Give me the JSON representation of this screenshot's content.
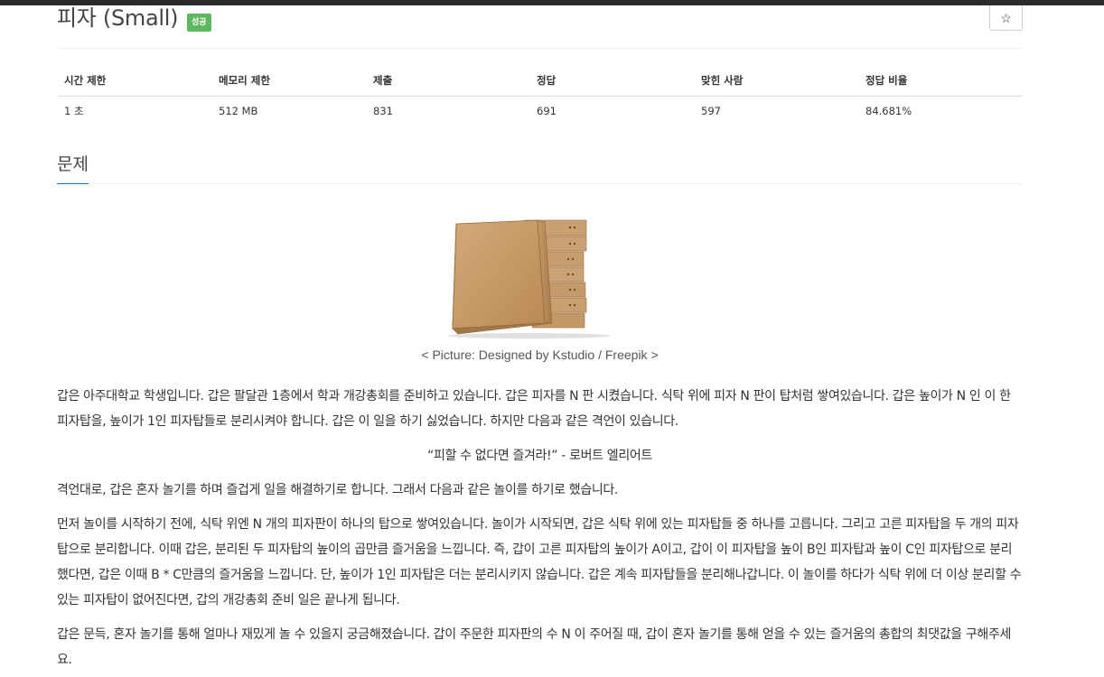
{
  "problem": {
    "title": "피자 (Small)",
    "status_badge": "성공",
    "star_icon": "☆"
  },
  "info_table": {
    "headers": [
      "시간 제한",
      "메모리 제한",
      "제출",
      "정답",
      "맞힌 사람",
      "정답 비율"
    ],
    "values": [
      "1 초",
      "512 MB",
      "831",
      "691",
      "597",
      "84.681%"
    ]
  },
  "section": {
    "title": "문제"
  },
  "image": {
    "caption": "< Picture: Designed by Kstudio / Freepik >"
  },
  "body": {
    "p1": "갑은 아주대학교 학생입니다. 갑은 팔달관 1층에서 학과 개강총회를 준비하고 있습니다. 갑은 피자를 N 판 시켰습니다. 식탁 위에 피자 N 판이 탑처럼 쌓여있습니다. 갑은 높이가 N 인 이 한 피자탑을, 높이가 1인 피자탑들로 분리시켜야 합니다. 갑은 이 일을 하기 싫었습니다. 하지만 다음과 같은 격언이 있습니다.",
    "quote": "“피할 수 없다면 즐겨라!” - 로버트 엘리어트",
    "p2": "격언대로, 갑은 혼자 놀기를 하며 즐겁게 일을 해결하기로 합니다. 그래서 다음과 같은 놀이를 하기로 했습니다.",
    "p3": "먼저 놀이를 시작하기 전에, 식탁 위엔 N 개의 피자판이 하나의 탑으로 쌓여있습니다. 놀이가 시작되면, 갑은 식탁 위에 있는 피자탑들 중 하나를 고릅니다. 그리고 고른 피자탑을 두 개의 피자탑으로 분리합니다. 이때 갑은, 분리된 두 피자탑의 높이의 곱만큼 즐거움을 느낍니다. 즉, 갑이 고른 피자탑의 높이가 A이고, 갑이 이 피자탑을 높이 B인 피자탑과 높이 C인 피자탑으로 분리했다면, 갑은 이때 B * C만큼의 즐거움을 느낍니다. 단, 높이가 1인 피자탑은 더는 분리시키지 않습니다. 갑은 계속 피자탑들을 분리해나갑니다. 이 놀이를 하다가 식탁 위에 더 이상 분리할 수 있는 피자탑이 없어진다면, 갑의 개강총회 준비 일은 끝나게 됩니다.",
    "p4": "갑은 문득, 혼자 놀기를 통해 얼마나 재밌게 놀 수 있을지 궁금해졌습니다. 갑이 주문한 피자판의 수 N 이 주어질 때, 갑이 혼자 놀기를 통해 얻을 수 있는 즐거움의 총합의 최댓값을 구해주세요."
  }
}
